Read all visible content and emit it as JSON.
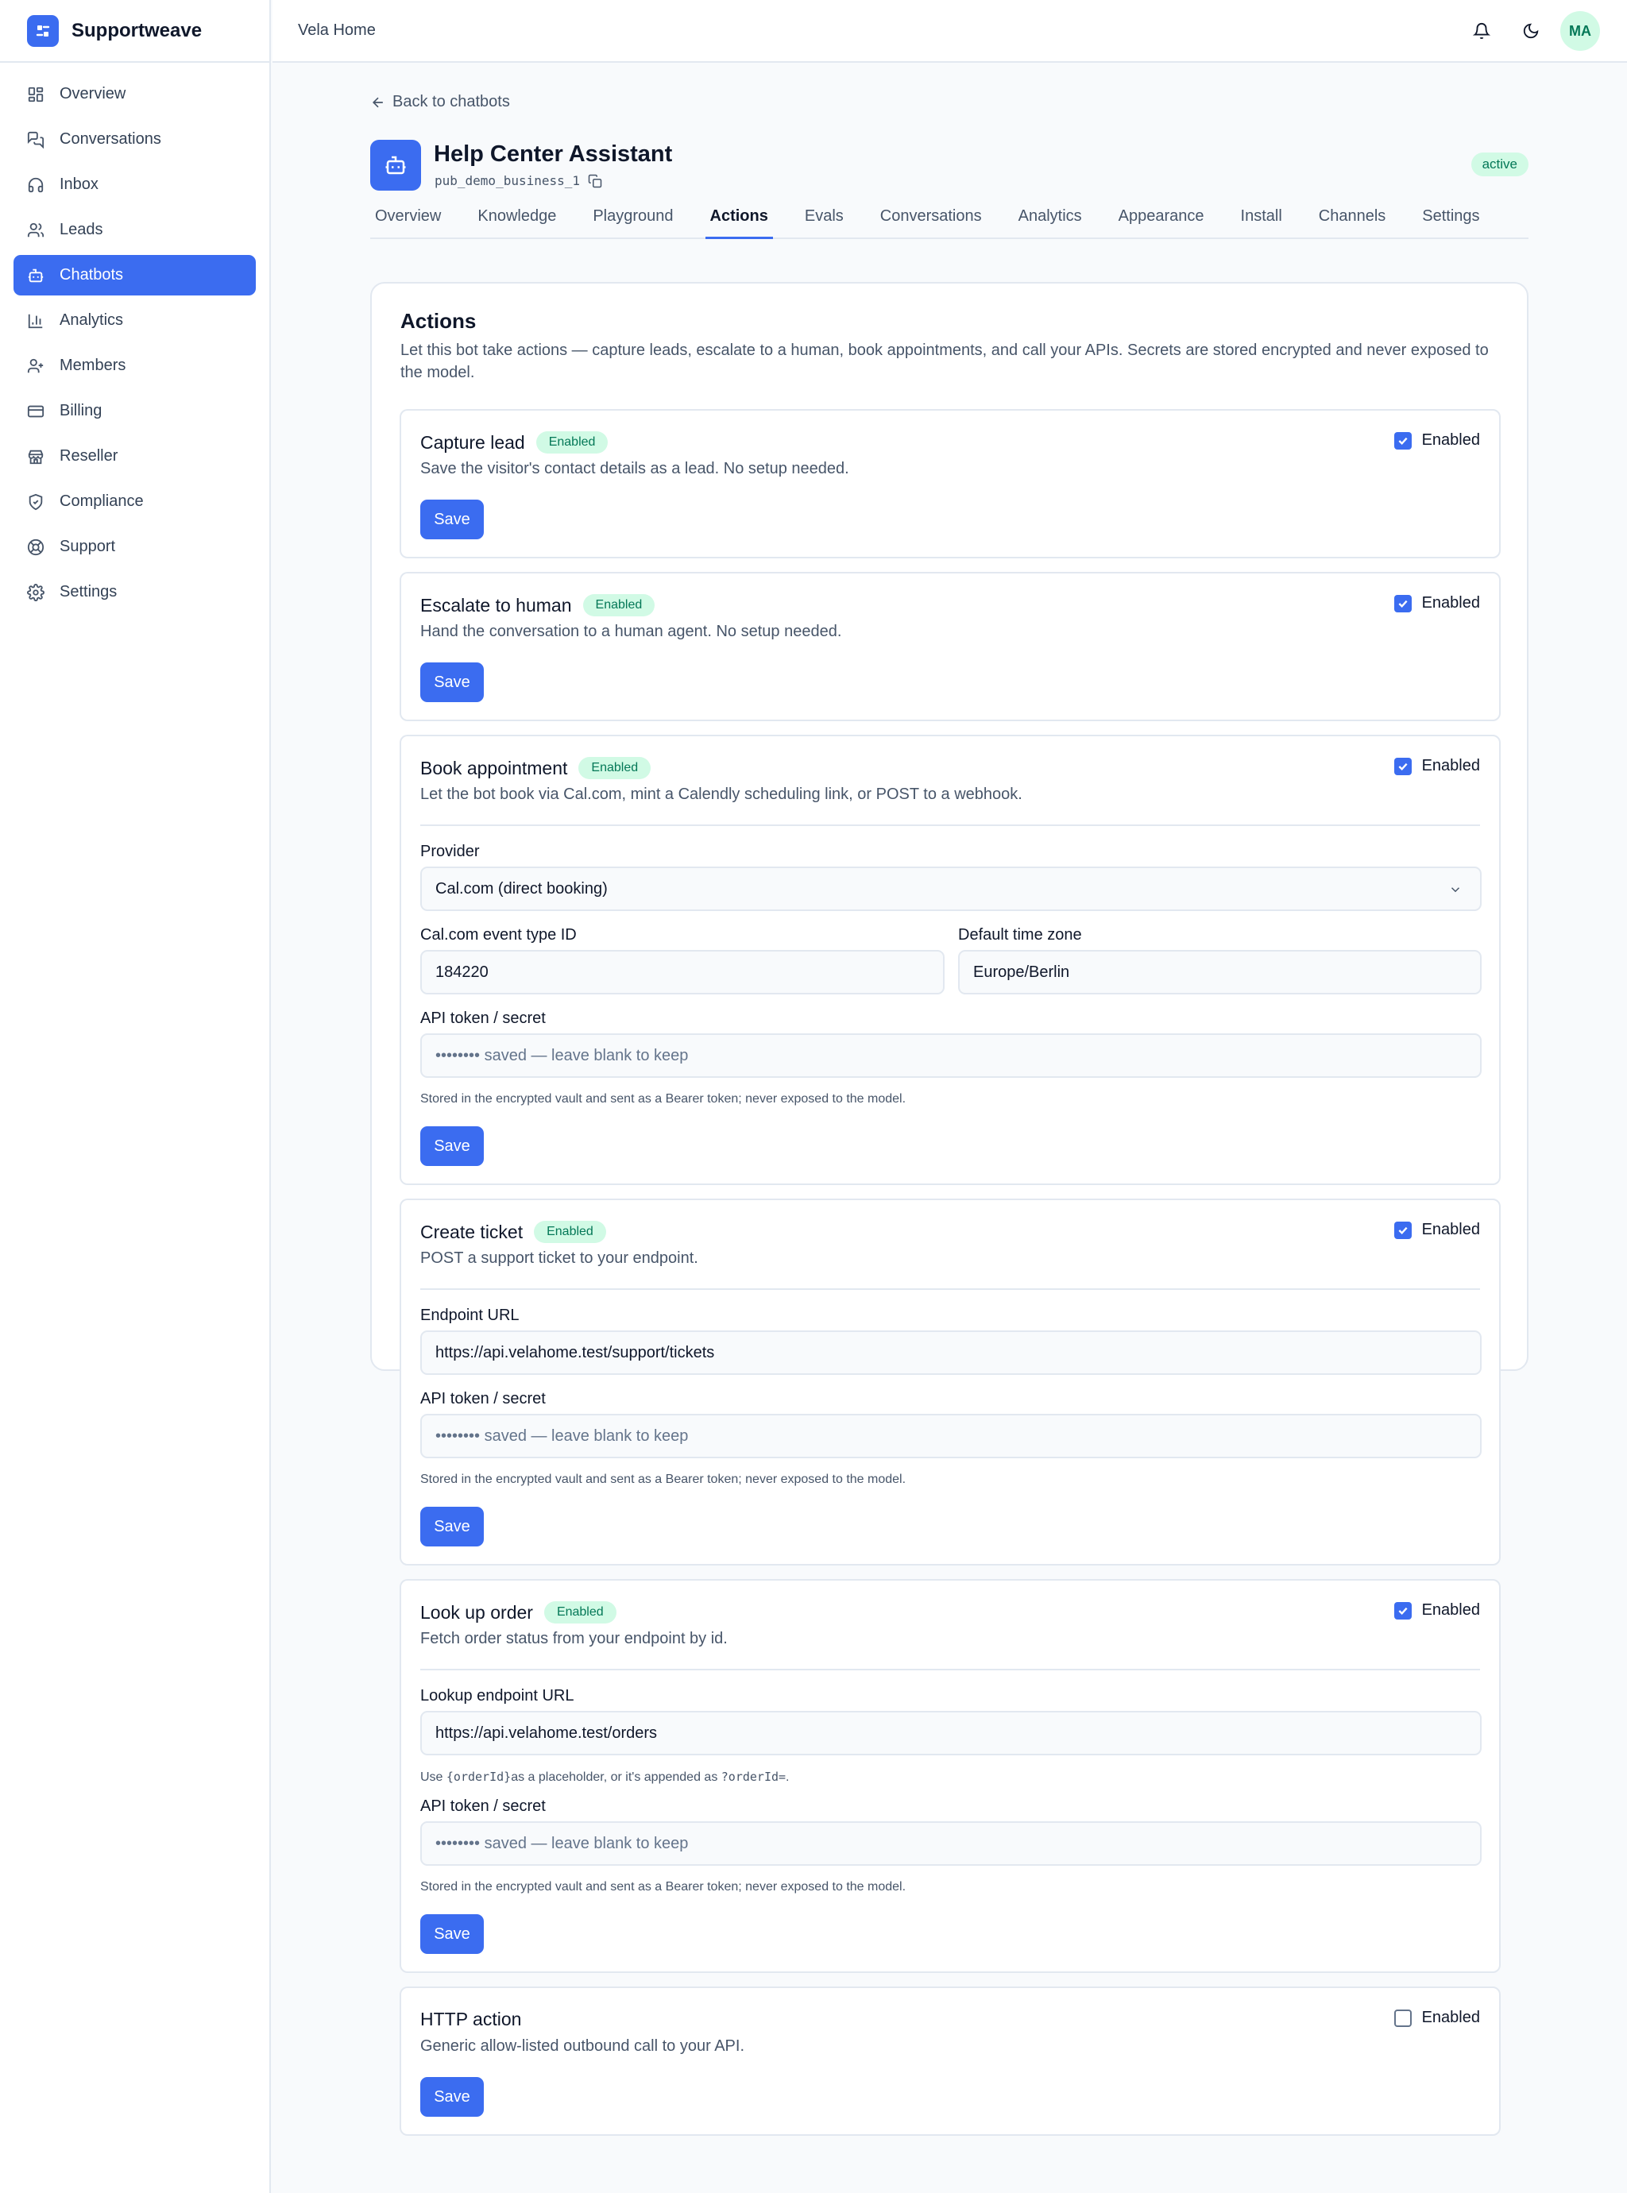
{
  "brand": {
    "name": "Supportweave"
  },
  "sidebar": {
    "items": [
      {
        "label": "Overview",
        "icon": "grid-icon"
      },
      {
        "label": "Conversations",
        "icon": "chat-bubbles-icon"
      },
      {
        "label": "Inbox",
        "icon": "headset-icon"
      },
      {
        "label": "Leads",
        "icon": "users-icon"
      },
      {
        "label": "Chatbots",
        "icon": "bot-icon",
        "active": true
      },
      {
        "label": "Analytics",
        "icon": "bar-chart-icon"
      },
      {
        "label": "Members",
        "icon": "user-plus-icon"
      },
      {
        "label": "Billing",
        "icon": "credit-card-icon"
      },
      {
        "label": "Reseller",
        "icon": "store-icon"
      },
      {
        "label": "Compliance",
        "icon": "shield-icon"
      },
      {
        "label": "Support",
        "icon": "lifebuoy-icon"
      },
      {
        "label": "Settings",
        "icon": "gear-icon"
      }
    ]
  },
  "topbar": {
    "workspace": "Vela Home",
    "avatar_initials": "MA"
  },
  "header": {
    "back_label": "Back to chatbots",
    "bot_name": "Help Center Assistant",
    "bot_id": "pub_demo_business_1",
    "status": "active"
  },
  "tabs": [
    "Overview",
    "Knowledge",
    "Playground",
    "Actions",
    "Evals",
    "Conversations",
    "Analytics",
    "Appearance",
    "Install",
    "Channels",
    "Settings"
  ],
  "active_tab": "Actions",
  "panel": {
    "title": "Actions",
    "description": "Let this bot take actions — capture leads, escalate to a human, book appointments, and call your APIs. Secrets are stored encrypted and never exposed to the model."
  },
  "common": {
    "enabled_badge": "Enabled",
    "enabled_checkbox": "Enabled",
    "save": "Save",
    "api_token_label": "API token / secret",
    "secret_placeholder": "•••••••• saved — leave blank to keep",
    "secret_hint": "Stored in the encrypted vault and sent as a Bearer token; never exposed to the model."
  },
  "actions": {
    "capture_lead": {
      "title": "Capture lead",
      "description": "Save the visitor's contact details as a lead. No setup needed.",
      "enabled": true
    },
    "escalate": {
      "title": "Escalate to human",
      "description": "Hand the conversation to a human agent. No setup needed.",
      "enabled": true
    },
    "book": {
      "title": "Book appointment",
      "description": "Let the bot book via Cal.com, mint a Calendly scheduling link, or POST to a webhook.",
      "enabled": true,
      "provider_label": "Provider",
      "provider_value": "Cal.com (direct booking)",
      "event_label": "Cal.com event type ID",
      "event_value": "184220",
      "tz_label": "Default time zone",
      "tz_value": "Europe/Berlin"
    },
    "ticket": {
      "title": "Create ticket",
      "description": "POST a support ticket to your endpoint.",
      "enabled": true,
      "endpoint_label": "Endpoint URL",
      "endpoint_value": "https://api.velahome.test/support/tickets"
    },
    "order": {
      "title": "Look up order",
      "description": "Fetch order status from your endpoint by id.",
      "enabled": true,
      "endpoint_label": "Lookup endpoint URL",
      "endpoint_value": "https://api.velahome.test/orders",
      "hint_prefix": "Use",
      "hint_code1": "{orderId}",
      "hint_middle": "as a placeholder, or it's appended as",
      "hint_code2": "?orderId=",
      "hint_suffix": "."
    },
    "http": {
      "title": "HTTP action",
      "description": "Generic allow-listed outbound call to your API.",
      "enabled": false
    }
  },
  "colors": {
    "accent": "#3b6cf0",
    "badge_bg": "#d1fae5",
    "badge_text": "#047857"
  }
}
